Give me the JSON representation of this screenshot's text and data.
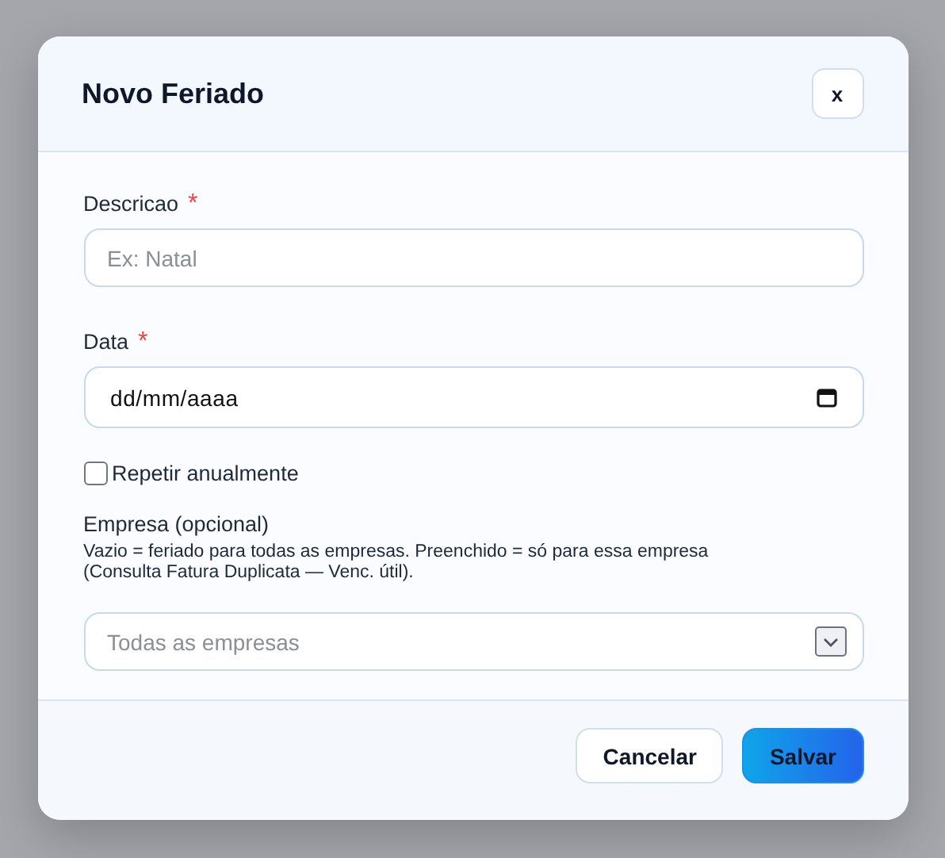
{
  "dialog": {
    "title": "Novo Feriado",
    "close_label": "x"
  },
  "fields": [
    {
      "kind": "text",
      "label": "Descricao",
      "required_mark": "*",
      "placeholder": "Ex: Natal"
    },
    {
      "kind": "date",
      "label": "Data",
      "required_mark": "*",
      "placeholder": "dd/mm/aaaa"
    },
    {
      "kind": "checkbox",
      "label": "Repetir anualmente",
      "checked": false
    },
    {
      "kind": "select",
      "label": "Empresa (opcional)",
      "hint": "Vazio = feriado para todas as empresas. Preenchido = só para essa empresa (Consulta Fatura Duplicata — Venc. útil).",
      "placeholder": "Todas as empresas"
    }
  ],
  "buttons": [
    {
      "kind": "secondary",
      "label": "Cancelar"
    },
    {
      "kind": "primary",
      "label": "Salvar"
    }
  ]
}
